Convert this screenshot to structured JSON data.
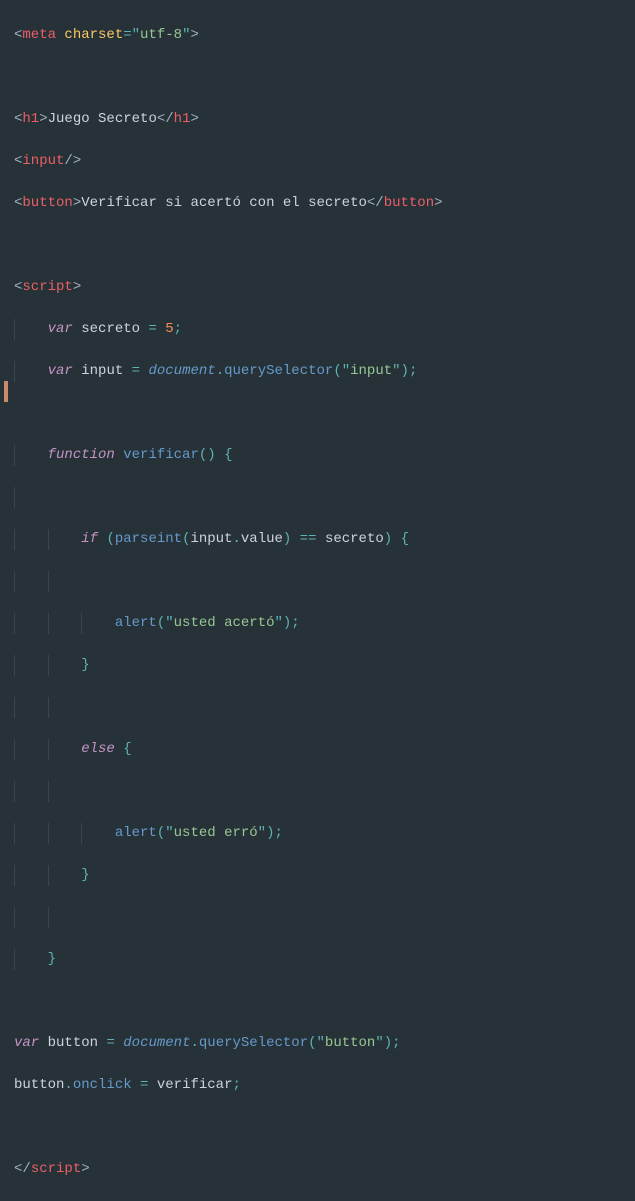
{
  "tokens": {
    "lt": "<",
    "gt": ">",
    "slash": "/",
    "eq": "=",
    "q": "\"",
    "semi": ";",
    "lp": "(",
    "rp": ")",
    "lb": "{",
    "rb": "}",
    "dot": ".",
    "deq": "=="
  },
  "tags": {
    "meta": "meta",
    "h1": "h1",
    "input": "input",
    "button": "button",
    "script": "script"
  },
  "attrs": {
    "charset": "charset"
  },
  "strings": {
    "utf8": "utf-8",
    "input": "input",
    "acerto": "usted acertó",
    "erro": "usted erró",
    "button": "button"
  },
  "text": {
    "h1": "Juego Secreto",
    "button": "Verificar si acertó con el secreto"
  },
  "kw": {
    "var": "var",
    "function": "function",
    "if": "if",
    "else": "else"
  },
  "ids": {
    "secreto": "secreto",
    "input": "input",
    "verificar": "verificar",
    "parseint": "parseint",
    "value": "value",
    "alert": "alert",
    "button": "button",
    "onclick": "onclick",
    "querySelector": "querySelector",
    "document": "document"
  },
  "nums": {
    "five": "5"
  },
  "indent": "    "
}
